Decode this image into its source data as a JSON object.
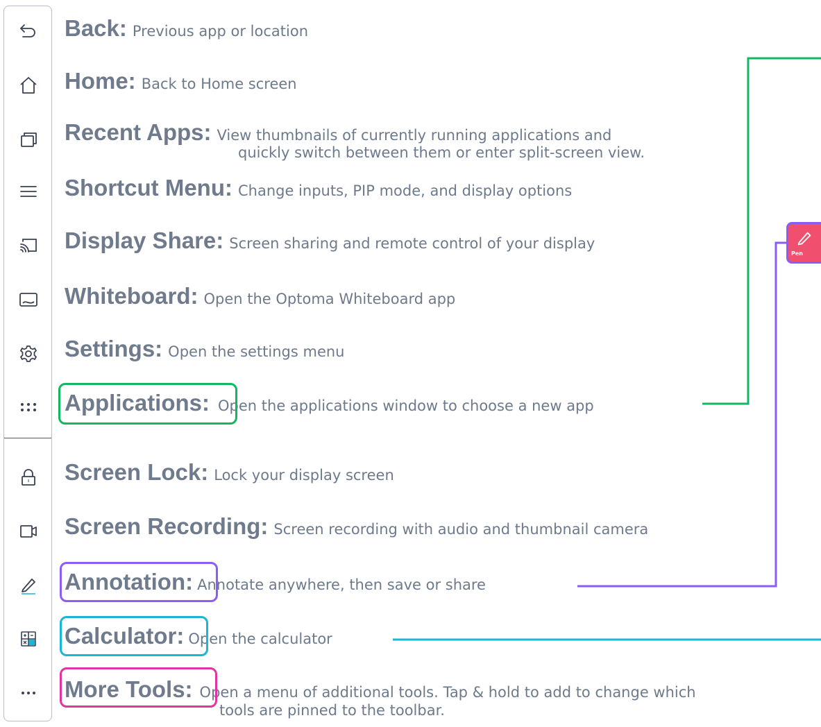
{
  "items": [
    {
      "label": "Back:",
      "desc": "Previous app or location",
      "icon": "back-arrow-icon"
    },
    {
      "label": "Home:",
      "desc": "Back to Home screen",
      "icon": "home-icon"
    },
    {
      "label": "Recent Apps:",
      "desc": "View thumbnails of currently running applications and",
      "desc_line2": "quickly switch between them or enter split-screen view.",
      "icon": "recent-apps-icon"
    },
    {
      "label": "Shortcut Menu:",
      "desc": "Change inputs, PIP mode, and display options",
      "icon": "menu-icon"
    },
    {
      "label": "Display Share:",
      "desc": "Screen sharing and remote control of your display",
      "icon": "cast-icon"
    },
    {
      "label": "Whiteboard:",
      "desc": "Open the Optoma Whiteboard app",
      "icon": "whiteboard-icon"
    },
    {
      "label": "Settings:",
      "desc": "Open the settings menu",
      "icon": "gear-icon"
    },
    {
      "label": "Applications:",
      "desc": "Open the applications window to choose a new app",
      "icon": "apps-grid-icon"
    },
    {
      "label": "Screen Lock:",
      "desc": "Lock your display screen",
      "icon": "lock-icon"
    },
    {
      "label": "Screen Recording:",
      "desc": "Screen recording with audio and thumbnail camera",
      "icon": "video-camera-icon"
    },
    {
      "label": "Annotation:",
      "desc": "Annotate anywhere, then save or share",
      "icon": "pencil-icon"
    },
    {
      "label": "Calculator:",
      "desc": "Open the calculator",
      "icon": "calculator-icon"
    },
    {
      "label": "More Tools:",
      "desc": "Open a menu of additional tools. Tap & hold to add to change which",
      "desc_line2": "tools are pinned to the toolbar.",
      "icon": "more-dots-icon"
    }
  ],
  "pen_button": {
    "label": "Pen"
  },
  "colors": {
    "applications": "#10b860",
    "annotation": "#8b5cf6",
    "calculator": "#1ab6d3",
    "more_tools": "#e0359e",
    "pen_bg": "#f0506e"
  }
}
